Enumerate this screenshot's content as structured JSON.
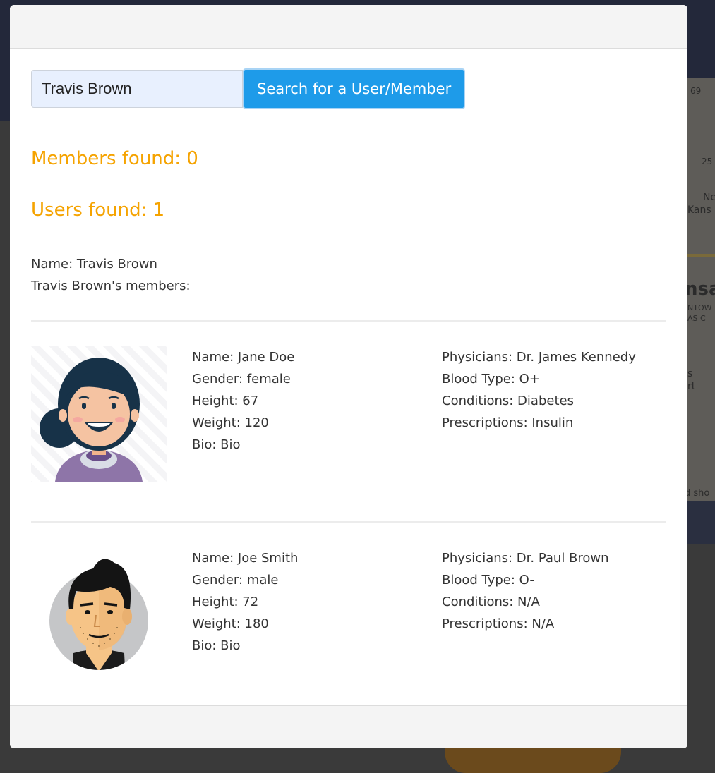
{
  "search": {
    "input_value": "Travis Brown",
    "button_label": "Search for a User/Member"
  },
  "results": {
    "members_found": "Members found: 0",
    "users_found": "Users found: 1"
  },
  "user": {
    "name_line": "Name: Travis Brown",
    "members_heading": "Travis Brown's members:"
  },
  "members": [
    {
      "avatar_icon": "female-avatar-icon",
      "name": "Name: Jane Doe",
      "gender": "Gender: female",
      "height": "Height: 67",
      "weight": "Weight: 120",
      "bio": "Bio: Bio",
      "physicians": "Physicians: Dr. James Kennedy",
      "blood_type": "Blood Type: O+",
      "conditions": "Conditions: Diabetes",
      "prescriptions": "Prescriptions: Insulin"
    },
    {
      "avatar_icon": "male-avatar-icon",
      "name": "Name: Joe Smith",
      "gender": "Gender: male",
      "height": "Height: 72",
      "weight": "Weight: 180",
      "bio": "Bio: Bio",
      "physicians": "Physicians: Dr. Paul Brown",
      "blood_type": "Blood Type: O-",
      "conditions": "Conditions: N/A",
      "prescriptions": "Prescriptions: N/A"
    }
  ],
  "background_map": {
    "labels": [
      "69",
      "25",
      "Ne",
      "Kans",
      "nsa",
      "NTOW",
      "AS C",
      "s",
      "rt",
      "d sho"
    ]
  },
  "colors": {
    "accent_orange": "#f5a300",
    "button_blue": "#1e9be9",
    "input_bg": "#e8f0fe"
  }
}
